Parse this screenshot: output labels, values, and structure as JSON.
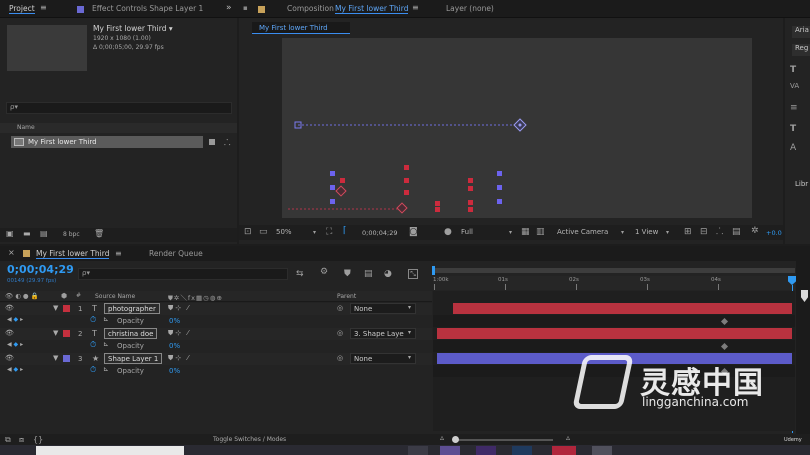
{
  "top_tabs": {
    "project": "Project",
    "effect_controls": "Effect Controls Shape Layer 1",
    "composition_prefix": "Composition",
    "composition_name": "My First lower Third",
    "layer": "Layer (none)",
    "expand": "»"
  },
  "project_panel": {
    "comp_name": "My First lower Third ▾",
    "comp_size": "1920 x 1080 (1.00)",
    "comp_duration": "Δ 0;00;05;00, 29.97 fps",
    "search_placeholder": "ρ▾",
    "name_header": "Name",
    "item_name": "My First lower Third",
    "bpc": "8 bpc"
  },
  "comp_panel": {
    "breadcrumb": "My First lower Third",
    "zoom": "50%",
    "timecode": "0;00;04;29",
    "resolution": "Full",
    "camera": "Active Camera",
    "views": "1 View",
    "exposure": "+0.0"
  },
  "char_panel": {
    "font": "Aria",
    "style": "Reg",
    "libraries": "Libr"
  },
  "timeline": {
    "tab": "My First lower Third",
    "render_queue": "Render Queue",
    "timecode": "0;00;04;29",
    "frame_info": "00149 (29.97 fps)",
    "search_placeholder": "ρ▾",
    "source_name_header": "Source Name",
    "parent_header": "Parent",
    "layers": [
      {
        "num": "1",
        "type": "T",
        "name": "photographer",
        "parent": "None",
        "color": "#c5303e",
        "prop": "Opacity",
        "prop_value": "0%"
      },
      {
        "num": "2",
        "type": "T",
        "name": "christina doe",
        "parent": "3. Shape Laye",
        "color": "#c5303e",
        "prop": "Opacity",
        "prop_value": "0%"
      },
      {
        "num": "3",
        "type": "★",
        "name": "Shape Layer 1",
        "parent": "None",
        "color": "#6a69d4",
        "prop": "Opacity",
        "prop_value": "0%"
      }
    ],
    "ruler": [
      "1:00k",
      "01s",
      "02s",
      "03s",
      "04s"
    ],
    "toggle_label": "Toggle Switches / Modes",
    "watermark_cn": "灵感中国",
    "watermark_url": "lingganchina.com",
    "udemy": "Udemy"
  },
  "colors": {
    "accent": "#3a8df0",
    "red_layer": "#c5303e",
    "shape_layer": "#6a69d4",
    "bar_red": "#b8323f",
    "bar_blue": "#5c5bc9"
  }
}
